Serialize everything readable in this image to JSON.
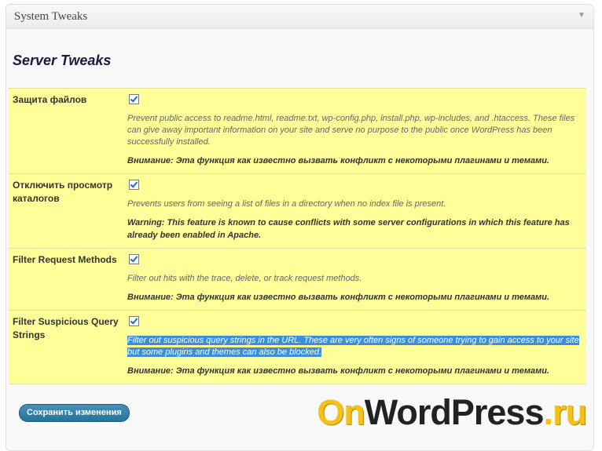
{
  "panel": {
    "title": "System Tweaks"
  },
  "section": {
    "title": "Server Tweaks"
  },
  "rows": [
    {
      "label": "Защита файлов",
      "checked": true,
      "description": "Prevent public access to readme.html, readme.txt, wp-config.php, install.php, wp-includes, and .htaccess. These files can give away important information on your site and serve no purpose to the public once WordPress has been successfully installed.",
      "warning": "Внимание: Эта функция как известно вызвать конфликт с некоторыми плагинами и темами."
    },
    {
      "label": "Отключить просмотр каталогов",
      "checked": true,
      "description": "Prevents users from seeing a list of files in a directory when no index file is present.",
      "warning": "Warning: This feature is known to cause conflicts with some server configurations in which this feature has already been enabled in Apache."
    },
    {
      "label": "Filter Request Methods",
      "checked": true,
      "description": "Filter out hits with the trace, delete, or track request methods.",
      "warning": "Внимание: Эта функция как известно вызвать конфликт с некоторыми плагинами и темами."
    },
    {
      "label": "Filter Suspicious Query Strings",
      "checked": true,
      "description": "Filter out suspicious query strings in the URL. These are very often signs of someone trying to gain access to your site but some plugins and themes can also be blocked.",
      "warning": "Внимание: Эта функция как известно вызвать конфликт с некоторыми плагинами и темами.",
      "highlighted": true
    }
  ],
  "save_button": {
    "label": "Сохранить изменения"
  },
  "watermark": {
    "on": "On",
    "word": "WordPress",
    "dot": ".",
    "ru": "ru"
  },
  "colors": {
    "row_bg": "#ffff99",
    "button": "#21759b",
    "selection": "#3b8fd8",
    "logo_yellow": "#f3c11a"
  }
}
